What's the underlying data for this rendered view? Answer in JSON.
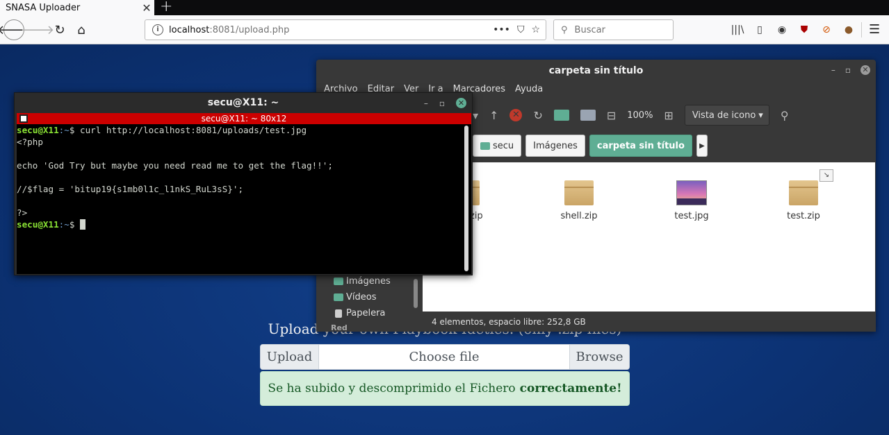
{
  "browser": {
    "tab_title": "SNASA Uploader",
    "url_host": "localhost",
    "url_rest": ":8081/upload.php",
    "search_placeholder": "Buscar"
  },
  "page": {
    "heading": "Upload your own Playbook Ideties. (only .zip files)",
    "upload_label": "Upload",
    "choose_label": "Choose file",
    "browse_label": "Browse",
    "alert_text": "Se ha subido y descomprimido el Fichero",
    "alert_strong": "correctamente!",
    "alert_color": "#d4edda"
  },
  "file_manager": {
    "title": "carpeta sin título",
    "menu": [
      "Archivo",
      "Editar",
      "Ver",
      "Ir a",
      "Marcadores",
      "Ayuda"
    ],
    "zoom": "100%",
    "view_mode": "Vista de icono",
    "path": [
      "secu",
      "Imágenes",
      "carpeta sin título"
    ],
    "sidebar": [
      "Imágenes",
      "Vídeos",
      "Papelera"
    ],
    "sidebar_cut": "Red",
    "files": [
      "legit.zip",
      "shell.zip",
      "test.jpg",
      "test.zip"
    ],
    "status": "4 elementos, espacio libre: 252,8 GB",
    "accent": "#5fae94"
  },
  "terminal": {
    "title": "secu@X11: ~",
    "bar_title": "secu@X11: ~ 80x12",
    "user": "secu@X11",
    "path": ":~",
    "command": "$ curl http://localhost:8081/uploads/test.jpg",
    "output": [
      "<?php",
      "",
      "echo 'God Try but maybe you need read me to get the flag!!';",
      "",
      "//$flag = 'bitup19{s1mb0l1c_l1nkS_RuL3sS}';",
      "",
      "?>"
    ],
    "prompt_end": "$ "
  }
}
